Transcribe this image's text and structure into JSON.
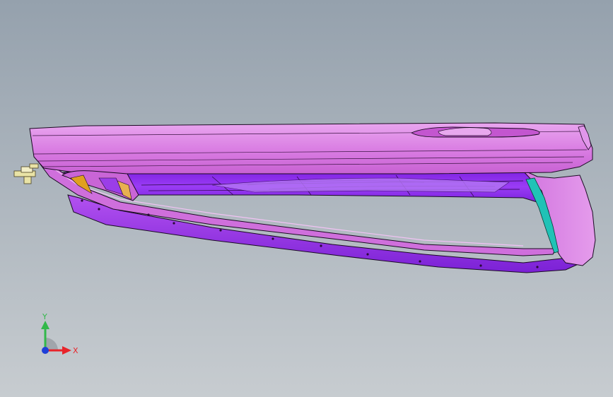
{
  "view": {
    "background_top": "#95a1ad",
    "background_bottom": "#c7ccd0"
  },
  "model": {
    "body_color": "#d76ee0",
    "body_light": "#e8a2ee",
    "body_shadow": "#a947b4",
    "inner_color": "#8c2cf0",
    "inner_dark": "#6a15c8",
    "edge_color": "#1a0a22",
    "insert_color": "#20c2b6",
    "clip_color": "#e9e3a6",
    "accent_color": "#e0a020"
  },
  "triad": {
    "x_label": "X",
    "y_label": "Y",
    "x_color": "#e8242a",
    "y_color": "#32b84a",
    "z_color": "#1f3fd8"
  }
}
